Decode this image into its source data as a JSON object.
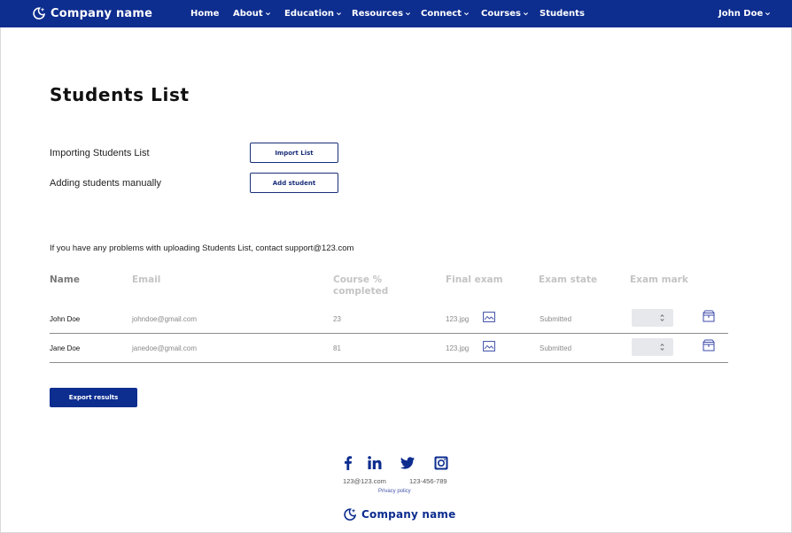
{
  "brand": {
    "name": "Company name",
    "logo_icon": "moon-sparkle-icon"
  },
  "nav": {
    "items": [
      {
        "label": "Home",
        "dropdown": false
      },
      {
        "label": "About",
        "dropdown": true
      },
      {
        "label": "Education",
        "dropdown": true
      },
      {
        "label": "Resources",
        "dropdown": true
      },
      {
        "label": "Connect",
        "dropdown": true
      },
      {
        "label": "Courses",
        "dropdown": true
      },
      {
        "label": "Students",
        "dropdown": false
      }
    ],
    "user": "John Doe"
  },
  "page": {
    "title": "Students List",
    "import_label": "Importing Students List",
    "import_button": "Import List",
    "add_label": "Adding students manually",
    "add_button": "Add student",
    "support_note": "If you have any problems with uploading Students List, contact support@123.com"
  },
  "table": {
    "headers": [
      "Name",
      "Email",
      "Course % completed",
      "Final exam",
      "Exam state",
      "Exam mark"
    ],
    "rows": [
      {
        "name": "John Doe",
        "email": "johndoe@gmail.com",
        "course_pct": "23",
        "final_exam": "123.jpg",
        "exam_state": "Submitted"
      },
      {
        "name": "Jane Doe",
        "email": "janedoe@gmail.com",
        "course_pct": "81",
        "final_exam": "123.jpg",
        "exam_state": "Submitted"
      }
    ]
  },
  "export_button": "Export results",
  "footer": {
    "social": [
      "facebook-icon",
      "linkedin-icon",
      "twitter-icon",
      "instagram-icon"
    ],
    "email": "123@123.com",
    "phone": "123-456-789",
    "privacy": "Privacy policy",
    "brand": "Company name"
  },
  "colors": {
    "primary": "#0d2d8f",
    "header_muted": "#c4c4c4",
    "text_muted": "#8a8a8a",
    "stepper_bg": "#e6e8ec"
  }
}
